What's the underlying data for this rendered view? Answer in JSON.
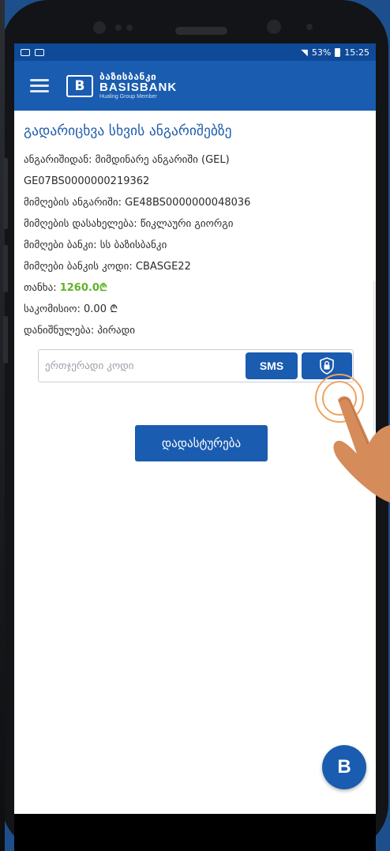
{
  "colors": {
    "brand_blue": "#1a5cb0",
    "status_bar": "#0f4a98",
    "title_blue": "#1f5bab",
    "amount_green": "#62b22a",
    "background": "#1d4f8c"
  },
  "status_bar": {
    "battery": "53%",
    "time": "15:25"
  },
  "header": {
    "menu_icon": "hamburger-icon",
    "logo_mark": "B",
    "logo_geo": "ბაზისბანკი",
    "logo_en": "BASISBANK",
    "logo_sub": "Hualing Group Member"
  },
  "page": {
    "title": "გადარიცხვა სხვის ანგარიშებზე"
  },
  "details": {
    "from_label": "ანგარიშიდან:",
    "from_value": "მიმდინარე ანგარიში (GEL)",
    "from_iban": "GE07BS0000000219362",
    "to_account_label": "მიმღების ანგარიში:",
    "to_account_value": "GE48BS0000000048036",
    "recipient_name_label": "მიმღების დასახელება:",
    "recipient_name_value": "წიკლაური გიორგი",
    "bank_label": "მიმღები ბანკი:",
    "bank_value": "სს ბაზისბანკი",
    "bank_code_label": "მიმღები ბანკის კოდი:",
    "bank_code_value": "CBASGE22",
    "amount_label": "თანხა:",
    "amount_value": "1260.0₾",
    "fee_label": "საკომისიო:",
    "fee_value": "0.00 ₾",
    "purpose_label": "დანიშნულება:",
    "purpose_value": "პირადი"
  },
  "otp": {
    "placeholder": "ერთჯერადი კოდი",
    "sms_label": "SMS",
    "token_icon": "lock-shield-icon"
  },
  "confirm_label": "დადასტურება",
  "fab_logo": "B"
}
